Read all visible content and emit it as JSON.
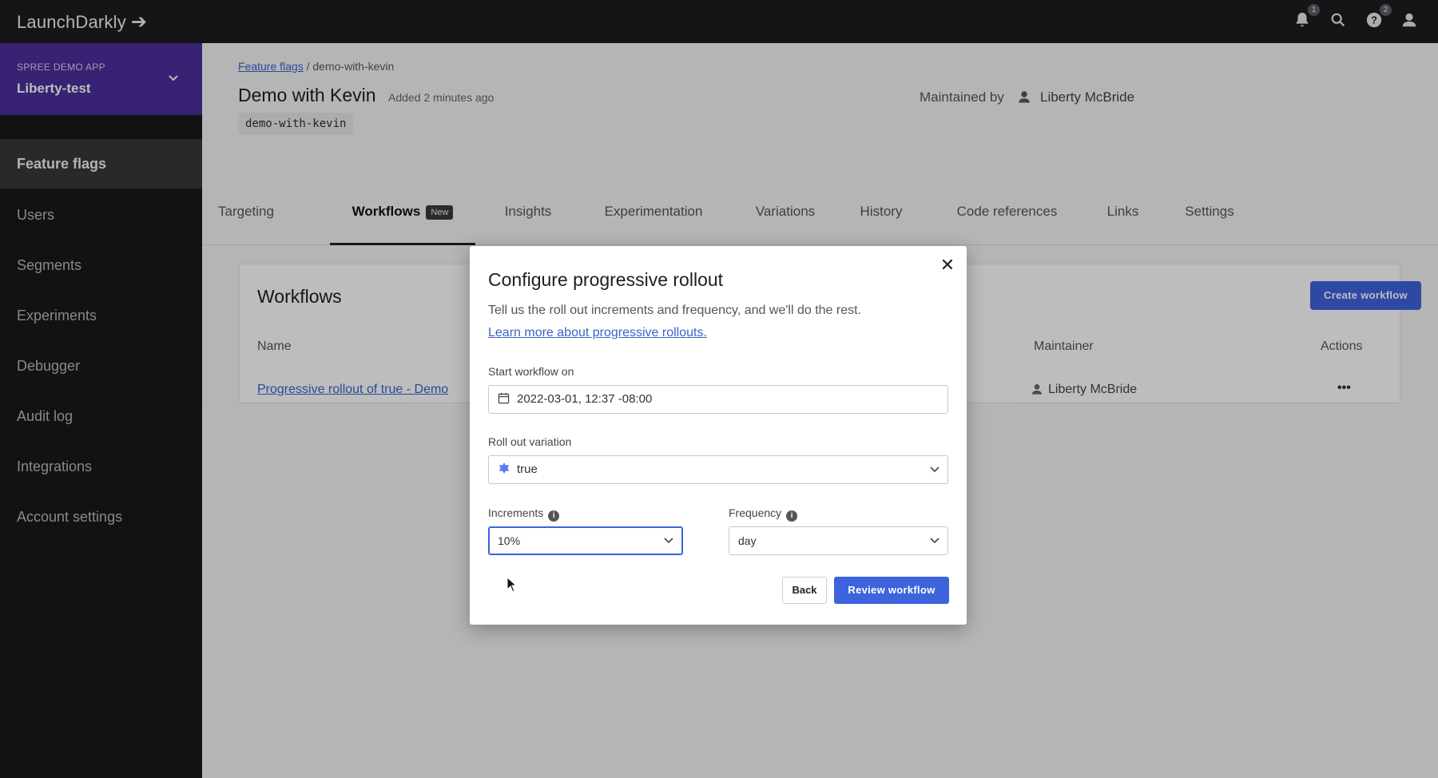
{
  "topbar": {
    "logo_text": "LaunchDarkly",
    "logo_icon": "arrow-right-icon",
    "notifications_badge": "1",
    "help_badge": "2"
  },
  "sidebar": {
    "project_kicker": "SPREE DEMO APP",
    "project_name": "Liberty-test",
    "items": [
      {
        "label": "Feature flags",
        "active": true
      },
      {
        "label": "Users",
        "active": false
      },
      {
        "label": "Segments",
        "active": false
      },
      {
        "label": "Experiments",
        "active": false
      },
      {
        "label": "Debugger",
        "active": false
      },
      {
        "label": "Audit log",
        "active": false
      },
      {
        "label": "Integrations",
        "active": false
      },
      {
        "label": "Account settings",
        "active": false
      }
    ]
  },
  "flag": {
    "breadcrumb_link": "Feature flags",
    "breadcrumb_sep": " / ",
    "breadcrumb_current": "demo-with-kevin",
    "title": "Demo with Kevin",
    "added": "Added 2 minutes ago",
    "key": "demo-with-kevin",
    "maintained_by_label": "Maintained by",
    "maintainer": "Liberty McBride"
  },
  "tabs": [
    {
      "label": "Targeting"
    },
    {
      "label": "Workflows",
      "badge": "New",
      "active": true
    },
    {
      "label": "Insights"
    },
    {
      "label": "Experimentation"
    },
    {
      "label": "Variations"
    },
    {
      "label": "History"
    },
    {
      "label": "Code references"
    },
    {
      "label": "Links"
    },
    {
      "label": "Settings"
    }
  ],
  "workflows": {
    "title": "Workflows",
    "create_button": "Create workflow",
    "columns": {
      "name": "Name",
      "maintainer": "Maintainer",
      "actions": "Actions"
    },
    "rows": [
      {
        "name": "Progressive rollout of true - Demo",
        "maintainer": "Liberty McBride",
        "actions": "•••"
      }
    ]
  },
  "modal": {
    "title": "Configure progressive rollout",
    "close_glyph": "✕",
    "description": "Tell us the roll out increments and frequency, and we'll do the rest.",
    "learn_more": "Learn more about progressive rollouts.",
    "start_label": "Start workflow on",
    "start_value": "2022-03-01, 12:37 -08:00",
    "variation_label": "Roll out variation",
    "variation_value": "true",
    "variation_color": "#5b7cf0",
    "increments_label": "Increments",
    "increments_value": "10%",
    "frequency_label": "Frequency",
    "frequency_value": "day",
    "back_button": "Back",
    "review_button": "Review workflow"
  },
  "colors": {
    "accent": "#3d63dd",
    "project_bg": "#4b2e9b",
    "topbar_bg": "#1d1d20",
    "sidebar_bg": "#19191c"
  }
}
